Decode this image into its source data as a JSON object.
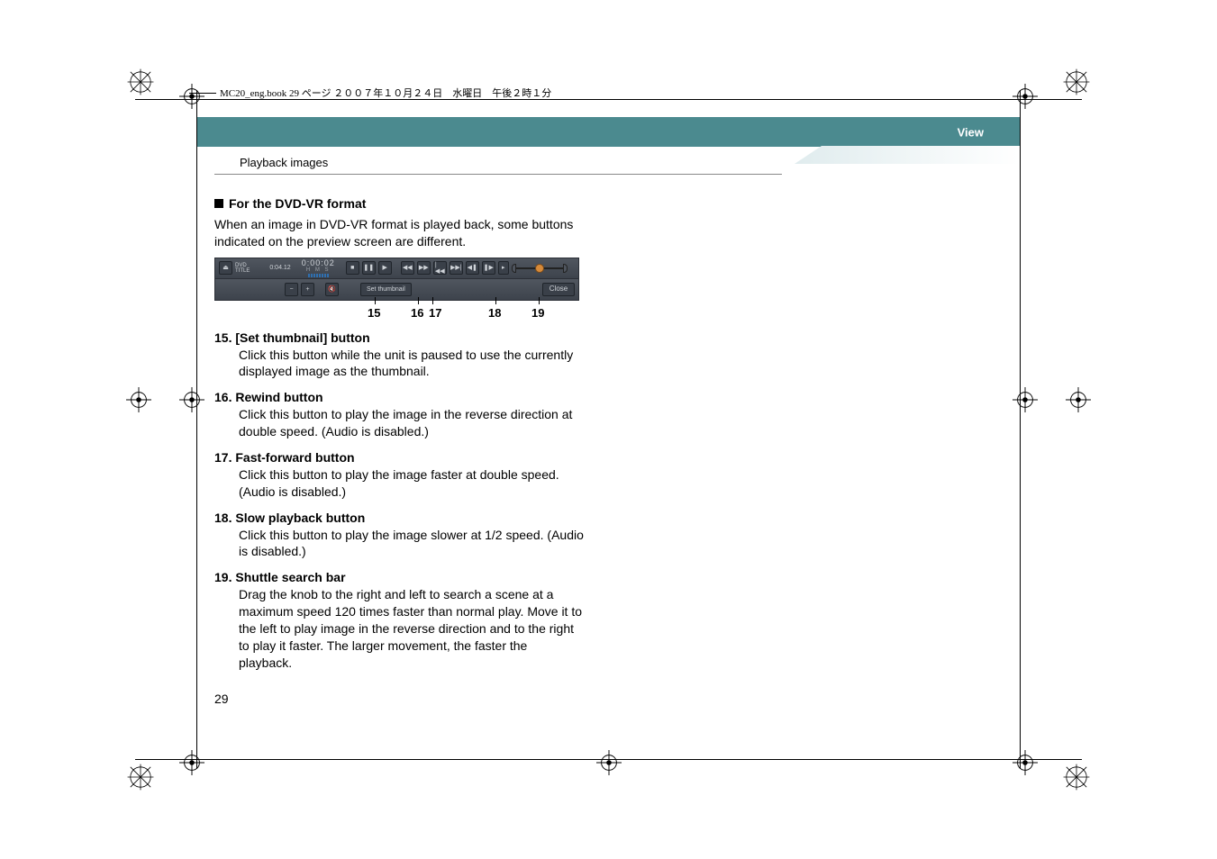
{
  "header_tag": "MC20_eng.book  29 ページ  ２００７年１０月２４日　水曜日　午後２時１分",
  "color_bar_label": "View",
  "section_title": "Playback images",
  "subheading": "For the DVD-VR format",
  "intro_para": "When an image in DVD-VR format is played back, some buttons indicated on the preview screen are different.",
  "toolbar": {
    "dvd_label": "DVD\nTITLE",
    "elapsed": "0:04.12",
    "time": "0:00:02",
    "time_sub": "H   M   S",
    "set_thumbnail": "Set thumbnail",
    "close": "Close"
  },
  "callouts": {
    "c15": "15",
    "c16": "16",
    "c17": "17",
    "c18": "18",
    "c19": "19"
  },
  "defs": [
    {
      "num": "15.",
      "title": "[Set thumbnail] button",
      "body": "Click this button while the unit is paused to use the currently displayed image as the thumbnail."
    },
    {
      "num": "16.",
      "title": "Rewind button",
      "body": "Click this button to play the image in the reverse direction at double speed. (Audio is disabled.)"
    },
    {
      "num": "17.",
      "title": "Fast-forward button",
      "body": "Click this button to play the image faster at double speed. (Audio is disabled.)"
    },
    {
      "num": "18.",
      "title": "Slow playback button",
      "body": "Click this button to play the image slower at 1/2 speed. (Audio is disabled.)"
    },
    {
      "num": "19.",
      "title": "Shuttle search bar",
      "body": "Drag the knob to the right and left to search a scene at a maximum speed 120 times faster than normal play. Move it to the left to play image in the reverse direction and to the right to play it faster. The larger movement, the faster the playback."
    }
  ],
  "page_number": "29"
}
